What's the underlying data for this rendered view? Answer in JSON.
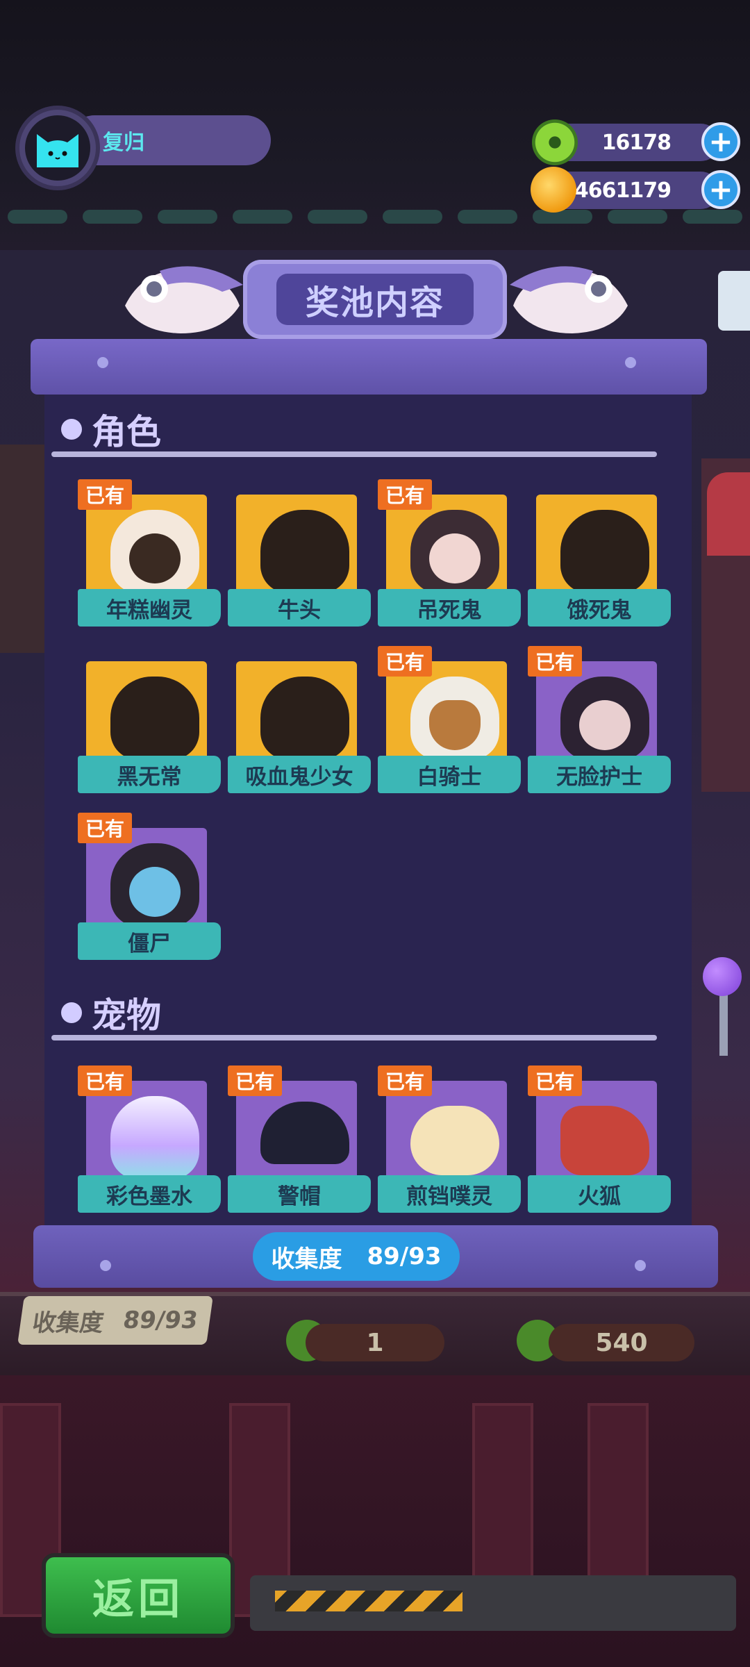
{
  "player": {
    "name": "复归",
    "avatar_icon": "cat-avatar-icon"
  },
  "currencies": [
    {
      "icon": "green-donut-icon",
      "value": "16178"
    },
    {
      "icon": "gold-planet-coin-icon",
      "value": "14661179"
    }
  ],
  "modal": {
    "title": "奖池内容",
    "sections": [
      {
        "title": "角色",
        "items": [
          {
            "name": "年糕幽灵",
            "owned": true,
            "color": "gold"
          },
          {
            "name": "牛头",
            "owned": false,
            "color": "gold"
          },
          {
            "name": "吊死鬼",
            "owned": true,
            "color": "gold"
          },
          {
            "name": "饿死鬼",
            "owned": false,
            "color": "gold"
          },
          {
            "name": "黑无常",
            "owned": false,
            "color": "gold"
          },
          {
            "name": "吸血鬼少女",
            "owned": false,
            "color": "gold"
          },
          {
            "name": "白骑士",
            "owned": true,
            "color": "gold"
          },
          {
            "name": "无脸护士",
            "owned": true,
            "color": "purple"
          },
          {
            "name": "僵尸",
            "owned": true,
            "color": "purple"
          }
        ]
      },
      {
        "title": "宠物",
        "items": [
          {
            "name": "彩色墨水",
            "owned": true,
            "color": "purple"
          },
          {
            "name": "警帽",
            "owned": true,
            "color": "purple"
          },
          {
            "name": "煎铛噗灵",
            "owned": true,
            "color": "purple"
          },
          {
            "name": "火狐",
            "owned": true,
            "color": "purple"
          }
        ]
      }
    ],
    "owned_badge": "已有",
    "collection_label": "收集度",
    "collection_value": "89/93"
  },
  "background": {
    "counter_label": "收集度",
    "counter_value": "89/93",
    "cost_1": "1",
    "cost_2": "540",
    "back_button": "返回"
  },
  "colors": {
    "gold_card": "#f2b12a",
    "purple_card": "#8a62c7",
    "label_teal": "#3cb7b6",
    "owned_orange": "#ee6f21",
    "pill_blue": "#2a9de4"
  }
}
